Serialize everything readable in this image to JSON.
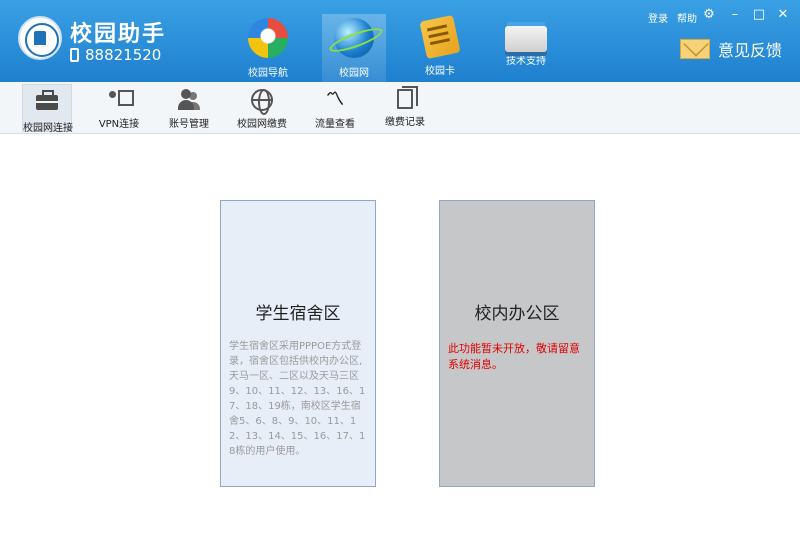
{
  "header": {
    "app_title": "校园助手",
    "phone": "88821520",
    "nav_tabs": [
      {
        "label": "校园导航",
        "icon": "campus-navigation-icon"
      },
      {
        "label": "校园网",
        "icon": "campus-network-globe-icon",
        "active": true
      },
      {
        "label": "校园卡",
        "icon": "campus-card-icon"
      },
      {
        "label": "技术支持",
        "icon": "tech-support-icon"
      }
    ],
    "top_right": {
      "login_label": "登录",
      "help_label": "帮助",
      "settings_icon": "gear-icon",
      "minimize_icon": "minimize-icon",
      "maximize_icon": "maximize-icon",
      "close_icon": "close-icon"
    },
    "feedback_label": "意见反馈",
    "colors": {
      "header_bg": "#2b8fdc",
      "accent": "#1f80cf"
    }
  },
  "toolbar": {
    "items": [
      {
        "label": "校园网连接",
        "icon": "briefcase-icon",
        "active": true
      },
      {
        "label": "VPN连接",
        "icon": "vpn-presenter-icon"
      },
      {
        "label": "账号管理",
        "icon": "users-icon"
      },
      {
        "label": "校园网缴费",
        "icon": "globe-icon"
      },
      {
        "label": "流量查看",
        "icon": "traffic-chart-icon"
      },
      {
        "label": "缴费记录",
        "icon": "document-icon"
      }
    ]
  },
  "cards": {
    "dorm": {
      "title": "学生宿舍区",
      "description": "学生宿舍区采用PPPOE方式登录，宿舍区包括供校内办公区,天马一区、二区以及天马三区9、10、11、12、13、16、17、18、19栋，南校区学生宿舍5、6、8、9、10、11、12、13、14、15、16、17、18栋的用户使用。"
    },
    "office": {
      "title": "校内办公区",
      "notice": "此功能暂未开放，敬请留意系统消息。",
      "notice_color": "#e00000"
    }
  }
}
